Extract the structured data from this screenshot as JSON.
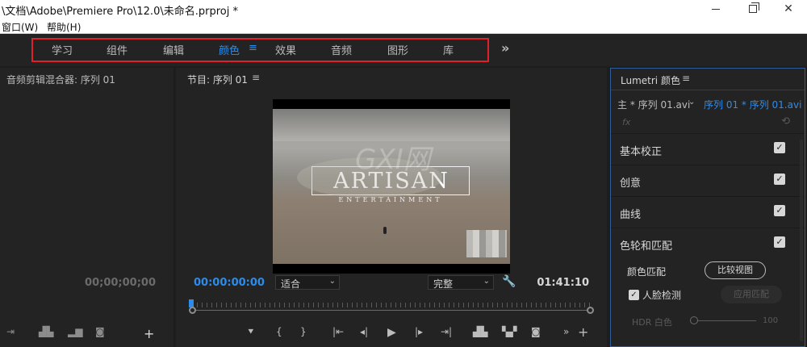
{
  "window": {
    "title": "\\文档\\Adobe\\Premiere Pro\\12.0\\未命名.prproj *",
    "minimize_icon": "minimize-icon",
    "maximize_icon": "restore-icon",
    "close_symbol": "✕"
  },
  "menubar": {
    "items": [
      "窗口(W)",
      "帮助(H)"
    ]
  },
  "workspace": {
    "tabs": [
      "学习",
      "组件",
      "编辑",
      "颜色",
      "效果",
      "音频",
      "图形",
      "库"
    ],
    "active_tab": "颜色",
    "menu_glyph": "≡",
    "more_glyph": "»",
    "accent_color": "#2d8ceb",
    "highlight_color": "#e0202a"
  },
  "audio_mixer": {
    "title": "音频剪辑混合器: 序列 01",
    "timecode": "00;00;00;00"
  },
  "program_monitor": {
    "title": "节目: 序列 01",
    "menu_glyph": "≡",
    "current_time": "00:00:00:00",
    "duration": "01:41:10",
    "fit_option": "适合",
    "quality_option": "完整",
    "video_title": "ARTISAN",
    "video_subtitle": "ENTERTAINMENT",
    "playhead_position_fraction": 0.0
  },
  "lumetri": {
    "title": "Lumetri 颜色",
    "menu_glyph": "≡",
    "master_clip": "主 * 序列 01.avi",
    "sequence_clip": "序列 01 * 序列 01.avi",
    "fx_label": "fx",
    "sections": [
      {
        "label": "基本校正",
        "checked": true
      },
      {
        "label": "创意",
        "checked": true
      },
      {
        "label": "曲线",
        "checked": true
      },
      {
        "label": "色轮和匹配",
        "checked": true
      }
    ],
    "color_match_label": "颜色匹配",
    "compare_view_button": "比较视图",
    "face_detection_label": "人脸检测",
    "face_detection_checked": true,
    "apply_match_button": "应用匹配",
    "hdr_label": "HDR 白色",
    "hdr_value": "100"
  },
  "watermark_text": "GXI网"
}
